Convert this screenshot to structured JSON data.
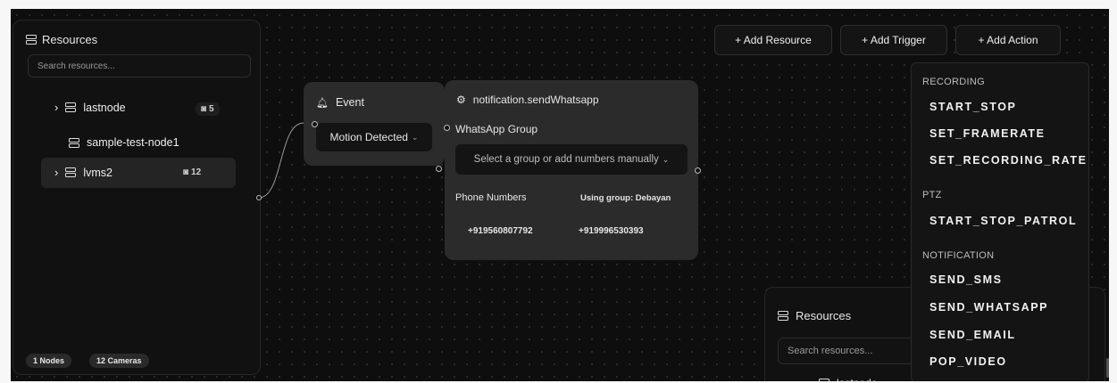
{
  "left_panel": {
    "title": "Resources",
    "search_placeholder": "Search resources...",
    "items": [
      {
        "label": "lastnode",
        "count": "5"
      },
      {
        "label": "sample-test-node1"
      },
      {
        "label": "lvms2",
        "count": "12"
      }
    ],
    "footer": {
      "nodes": "1 Nodes",
      "cameras": "12 Cameras"
    }
  },
  "toolbar": {
    "add_resource": "+ Add Resource",
    "add_trigger": "+ Add Trigger",
    "add_action": "+ Add Action"
  },
  "event_node": {
    "title": "Event",
    "select_value": "Motion Detected"
  },
  "action_node": {
    "title": "notification.sendWhatsapp",
    "group_label": "WhatsApp Group",
    "group_placeholder": "Select a group or add numbers manually",
    "phone_label": "Phone Numbers",
    "using_group": "Using group: Debayan",
    "phones": [
      "+919560807792",
      "+919996530393"
    ]
  },
  "action_menu": {
    "sections": [
      {
        "title": "RECORDING",
        "items": [
          "START_STOP",
          "SET_FRAMERATE",
          "SET_RECORDING_RATE"
        ]
      },
      {
        "title": "PTZ",
        "items": [
          "START_STOP_PATROL"
        ]
      },
      {
        "title": "NOTIFICATION",
        "items": [
          "SEND_SMS",
          "SEND_WHATSAPP",
          "SEND_EMAIL",
          "POP_VIDEO"
        ]
      }
    ]
  },
  "right_panel": {
    "title": "Resources",
    "search_placeholder": "Search resources...",
    "partial_item": "lastnode"
  }
}
